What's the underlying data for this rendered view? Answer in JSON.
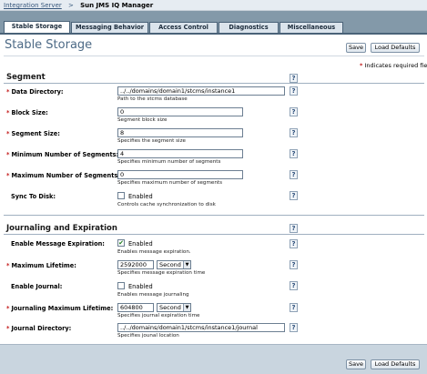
{
  "breadcrumb": {
    "root": "Integration Server",
    "separator": ">",
    "current": "Sun JMS IQ Manager"
  },
  "tabs": [
    "Stable Storage",
    "Messaging Behavior",
    "Access Control",
    "Diagnostics",
    "Miscellaneous"
  ],
  "active_tab": "Stable Storage",
  "page_title": "Stable Storage",
  "buttons": {
    "save": "Save",
    "load_defaults": "Load Defaults"
  },
  "required_legend": {
    "star": "*",
    "text": "Indicates required field"
  },
  "help_icon": "?",
  "segment": {
    "title": "Segment",
    "data_directory": {
      "label": "Data Directory:",
      "value": "../../domains/domain1/stcms/instance1",
      "help": "Path to the stcms database"
    },
    "block_size": {
      "label": "Block Size:",
      "value": "0",
      "help": "Segment block size"
    },
    "segment_size": {
      "label": "Segment Size:",
      "value": "8",
      "help": "Specifies the segment size"
    },
    "min_segments": {
      "label": "Minimum Number of Segments:",
      "value": "4",
      "help": "Specifies minimum number of segments"
    },
    "max_segments": {
      "label": "Maximum Number of Segments:",
      "value": "0",
      "help": "Specifies maximum number of segments"
    },
    "sync_to_disk": {
      "label": "Sync To Disk:",
      "checkbox": "Enabled",
      "checked": false,
      "help": "Controls cache synchronization to disk"
    }
  },
  "journaling": {
    "title": "Journaling and Expiration",
    "enable_expiration": {
      "label": "Enable Message Expiration:",
      "checkbox": "Enabled",
      "checked": true,
      "help": "Enables message expiration."
    },
    "max_lifetime": {
      "label": "Maximum Lifetime:",
      "value": "2592000",
      "unit": "Second",
      "help": "Specifies message expiration time"
    },
    "enable_journal": {
      "label": "Enable Journal:",
      "checkbox": "Enabled",
      "checked": false,
      "help": "Enables message journaling"
    },
    "journal_max_lifetime": {
      "label": "Journaling Maximum Lifetime:",
      "value": "604800",
      "unit": "Second",
      "help": "Specifies journal expiration time"
    },
    "journal_directory": {
      "label": "Journal Directory:",
      "value": "../../domains/domain1/stcms/instance1/journal",
      "help": "Specifies jounal location"
    }
  },
  "colors": {
    "tabbar": "#8399a9",
    "title": "#4d6a86",
    "required": "#c31818",
    "footer": "#c9d5df"
  }
}
